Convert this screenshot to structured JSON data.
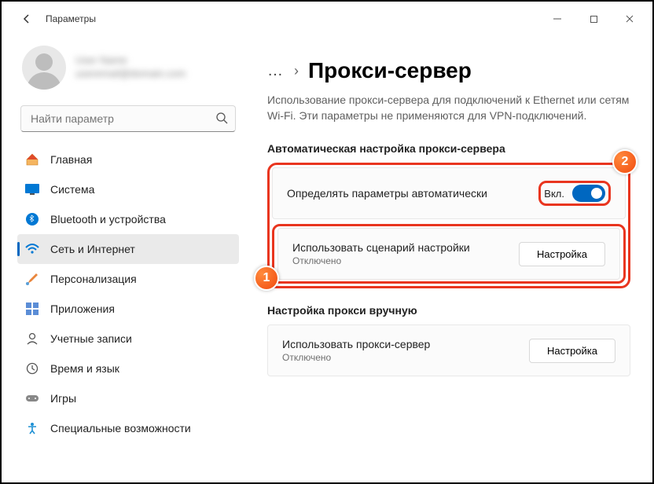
{
  "window": {
    "title": "Параметры"
  },
  "user": {
    "name": "User Name",
    "email": "useremail@domain.com"
  },
  "search": {
    "placeholder": "Найти параметр"
  },
  "sidebar": {
    "items": [
      {
        "label": "Главная"
      },
      {
        "label": "Система"
      },
      {
        "label": "Bluetooth и устройства"
      },
      {
        "label": "Сеть и Интернет"
      },
      {
        "label": "Персонализация"
      },
      {
        "label": "Приложения"
      },
      {
        "label": "Учетные записи"
      },
      {
        "label": "Время и язык"
      },
      {
        "label": "Игры"
      },
      {
        "label": "Специальные возможности"
      }
    ]
  },
  "breadcrumb": {
    "ellipsis": "…",
    "sep": "›"
  },
  "page": {
    "title": "Прокси-сервер",
    "desc": "Использование прокси-сервера для подключений к Ethernet или сетям Wi-Fi. Эти параметры не применяются для VPN-подключений."
  },
  "sections": {
    "auto_label": "Автоматическая настройка прокси-сервера",
    "manual_label": "Настройка прокси вручную"
  },
  "cards": {
    "detect": {
      "title": "Определять параметры автоматически",
      "toggle_label": "Вкл."
    },
    "script": {
      "title": "Использовать сценарий настройки",
      "status": "Отключено",
      "button": "Настройка"
    },
    "manual": {
      "title": "Использовать прокси-сервер",
      "status": "Отключено",
      "button": "Настройка"
    }
  },
  "markers": {
    "one": "1",
    "two": "2"
  },
  "colors": {
    "accent": "#0067c0",
    "highlight": "#e9351f"
  }
}
